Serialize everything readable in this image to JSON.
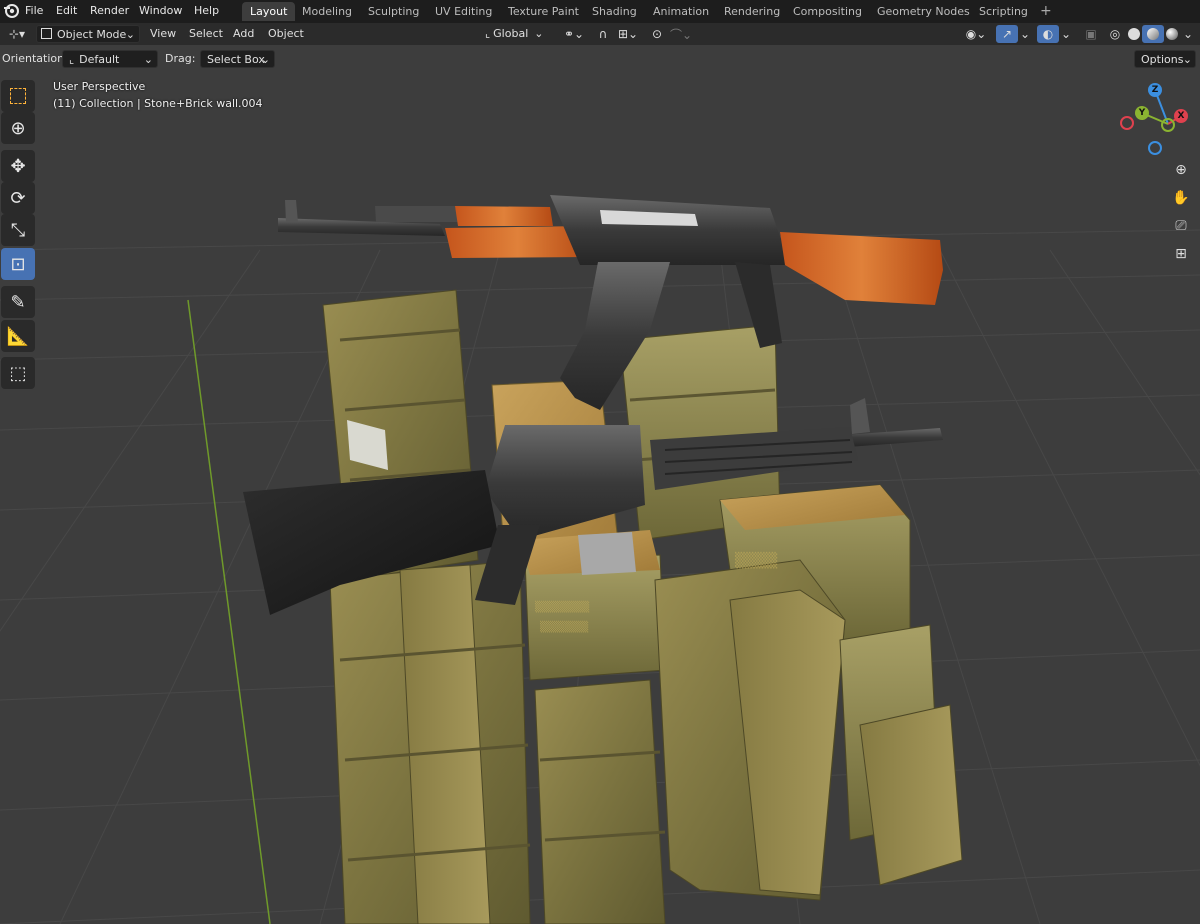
{
  "app": {
    "logo_icon": "blender-logo-icon"
  },
  "menubar": {
    "items": [
      "File",
      "Edit",
      "Render",
      "Window",
      "Help"
    ]
  },
  "workspaces": {
    "tabs": [
      "Layout",
      "Modeling",
      "Sculpting",
      "UV Editing",
      "Texture Paint",
      "Shading",
      "Animation",
      "Rendering",
      "Compositing",
      "Geometry Nodes",
      "Scripting"
    ],
    "active": "Layout",
    "add_label": "+"
  },
  "header": {
    "editor_type_icon": "3d-viewport-icon",
    "mode": "Object Mode",
    "view_menu": "View",
    "select_menu": "Select",
    "add_menu": "Add",
    "object_menu": "Object",
    "transform_orientation": "Global",
    "pivot_icon": "link-icon",
    "snap_icon": "magnet-icon",
    "proportional_icon": "proportional-edit-icon",
    "visibility_icon": "eye-icon",
    "gizmo_icon": "gizmo-icon",
    "overlay_icon": "overlay-icon",
    "xray_icon": "xray-icon",
    "shading_modes": [
      "wireframe",
      "solid",
      "material",
      "rendered"
    ],
    "active_shading": "material"
  },
  "toolsettings": {
    "orientation_label": "Orientation:",
    "orientation_value": "Default",
    "drag_label": "Drag:",
    "drag_value": "Select Box",
    "options_label": "Options"
  },
  "viewport": {
    "view_name": "User Perspective",
    "collection_info": "(11) Collection | Stone+Brick wall.004"
  },
  "toolbar": {
    "tools": [
      {
        "name": "select-box-tool",
        "icon": "select-box-icon",
        "active": false
      },
      {
        "name": "cursor-tool",
        "icon": "cursor-icon",
        "active": false
      },
      {
        "name": "move-tool",
        "icon": "move-icon",
        "active": false
      },
      {
        "name": "rotate-tool",
        "icon": "rotate-icon",
        "active": false
      },
      {
        "name": "scale-tool",
        "icon": "scale-icon",
        "active": false
      },
      {
        "name": "transform-tool",
        "icon": "transform-icon",
        "active": true
      },
      {
        "name": "annotate-tool",
        "icon": "annotate-icon",
        "active": false
      },
      {
        "name": "measure-tool",
        "icon": "measure-icon",
        "active": false
      },
      {
        "name": "add-cube-tool",
        "icon": "add-cube-icon",
        "active": false
      }
    ]
  },
  "navigation_gizmo": {
    "axes": [
      "X",
      "Y",
      "Z"
    ],
    "colors": {
      "x": "#e0414e",
      "y": "#8bb431",
      "z": "#3b8fe0"
    }
  },
  "nav_buttons": [
    "zoom-icon",
    "hand-pan-icon",
    "camera-icon",
    "grid-ortho-icon"
  ],
  "colors": {
    "accent": "#4772b3",
    "topbar_bg": "#1d1d1d",
    "header_bg": "#2b2b2b",
    "viewport_bg": "#3d3d3d"
  }
}
